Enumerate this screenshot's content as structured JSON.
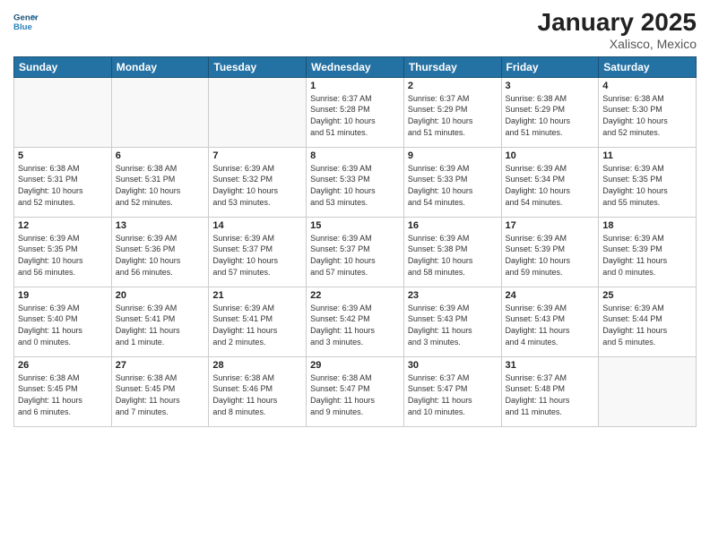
{
  "header": {
    "logo_line1": "General",
    "logo_line2": "Blue",
    "month": "January 2025",
    "location": "Xalisco, Mexico"
  },
  "days_of_week": [
    "Sunday",
    "Monday",
    "Tuesday",
    "Wednesday",
    "Thursday",
    "Friday",
    "Saturday"
  ],
  "weeks": [
    [
      {
        "day": "",
        "info": ""
      },
      {
        "day": "",
        "info": ""
      },
      {
        "day": "",
        "info": ""
      },
      {
        "day": "1",
        "info": "Sunrise: 6:37 AM\nSunset: 5:28 PM\nDaylight: 10 hours\nand 51 minutes."
      },
      {
        "day": "2",
        "info": "Sunrise: 6:37 AM\nSunset: 5:29 PM\nDaylight: 10 hours\nand 51 minutes."
      },
      {
        "day": "3",
        "info": "Sunrise: 6:38 AM\nSunset: 5:29 PM\nDaylight: 10 hours\nand 51 minutes."
      },
      {
        "day": "4",
        "info": "Sunrise: 6:38 AM\nSunset: 5:30 PM\nDaylight: 10 hours\nand 52 minutes."
      }
    ],
    [
      {
        "day": "5",
        "info": "Sunrise: 6:38 AM\nSunset: 5:31 PM\nDaylight: 10 hours\nand 52 minutes."
      },
      {
        "day": "6",
        "info": "Sunrise: 6:38 AM\nSunset: 5:31 PM\nDaylight: 10 hours\nand 52 minutes."
      },
      {
        "day": "7",
        "info": "Sunrise: 6:39 AM\nSunset: 5:32 PM\nDaylight: 10 hours\nand 53 minutes."
      },
      {
        "day": "8",
        "info": "Sunrise: 6:39 AM\nSunset: 5:33 PM\nDaylight: 10 hours\nand 53 minutes."
      },
      {
        "day": "9",
        "info": "Sunrise: 6:39 AM\nSunset: 5:33 PM\nDaylight: 10 hours\nand 54 minutes."
      },
      {
        "day": "10",
        "info": "Sunrise: 6:39 AM\nSunset: 5:34 PM\nDaylight: 10 hours\nand 54 minutes."
      },
      {
        "day": "11",
        "info": "Sunrise: 6:39 AM\nSunset: 5:35 PM\nDaylight: 10 hours\nand 55 minutes."
      }
    ],
    [
      {
        "day": "12",
        "info": "Sunrise: 6:39 AM\nSunset: 5:35 PM\nDaylight: 10 hours\nand 56 minutes."
      },
      {
        "day": "13",
        "info": "Sunrise: 6:39 AM\nSunset: 5:36 PM\nDaylight: 10 hours\nand 56 minutes."
      },
      {
        "day": "14",
        "info": "Sunrise: 6:39 AM\nSunset: 5:37 PM\nDaylight: 10 hours\nand 57 minutes."
      },
      {
        "day": "15",
        "info": "Sunrise: 6:39 AM\nSunset: 5:37 PM\nDaylight: 10 hours\nand 57 minutes."
      },
      {
        "day": "16",
        "info": "Sunrise: 6:39 AM\nSunset: 5:38 PM\nDaylight: 10 hours\nand 58 minutes."
      },
      {
        "day": "17",
        "info": "Sunrise: 6:39 AM\nSunset: 5:39 PM\nDaylight: 10 hours\nand 59 minutes."
      },
      {
        "day": "18",
        "info": "Sunrise: 6:39 AM\nSunset: 5:39 PM\nDaylight: 11 hours\nand 0 minutes."
      }
    ],
    [
      {
        "day": "19",
        "info": "Sunrise: 6:39 AM\nSunset: 5:40 PM\nDaylight: 11 hours\nand 0 minutes."
      },
      {
        "day": "20",
        "info": "Sunrise: 6:39 AM\nSunset: 5:41 PM\nDaylight: 11 hours\nand 1 minute."
      },
      {
        "day": "21",
        "info": "Sunrise: 6:39 AM\nSunset: 5:41 PM\nDaylight: 11 hours\nand 2 minutes."
      },
      {
        "day": "22",
        "info": "Sunrise: 6:39 AM\nSunset: 5:42 PM\nDaylight: 11 hours\nand 3 minutes."
      },
      {
        "day": "23",
        "info": "Sunrise: 6:39 AM\nSunset: 5:43 PM\nDaylight: 11 hours\nand 3 minutes."
      },
      {
        "day": "24",
        "info": "Sunrise: 6:39 AM\nSunset: 5:43 PM\nDaylight: 11 hours\nand 4 minutes."
      },
      {
        "day": "25",
        "info": "Sunrise: 6:39 AM\nSunset: 5:44 PM\nDaylight: 11 hours\nand 5 minutes."
      }
    ],
    [
      {
        "day": "26",
        "info": "Sunrise: 6:38 AM\nSunset: 5:45 PM\nDaylight: 11 hours\nand 6 minutes."
      },
      {
        "day": "27",
        "info": "Sunrise: 6:38 AM\nSunset: 5:45 PM\nDaylight: 11 hours\nand 7 minutes."
      },
      {
        "day": "28",
        "info": "Sunrise: 6:38 AM\nSunset: 5:46 PM\nDaylight: 11 hours\nand 8 minutes."
      },
      {
        "day": "29",
        "info": "Sunrise: 6:38 AM\nSunset: 5:47 PM\nDaylight: 11 hours\nand 9 minutes."
      },
      {
        "day": "30",
        "info": "Sunrise: 6:37 AM\nSunset: 5:47 PM\nDaylight: 11 hours\nand 10 minutes."
      },
      {
        "day": "31",
        "info": "Sunrise: 6:37 AM\nSunset: 5:48 PM\nDaylight: 11 hours\nand 11 minutes."
      },
      {
        "day": "",
        "info": ""
      }
    ]
  ]
}
